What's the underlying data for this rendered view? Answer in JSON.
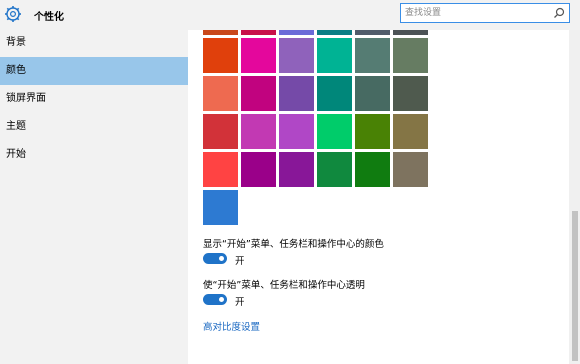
{
  "header": {
    "title": "个性化"
  },
  "search": {
    "placeholder": "查找设置"
  },
  "sidebar": {
    "items": [
      {
        "label": "背景",
        "active": false
      },
      {
        "label": "颜色",
        "active": true
      },
      {
        "label": "锁屏界面",
        "active": false
      },
      {
        "label": "主题",
        "active": false
      },
      {
        "label": "开始",
        "active": false
      }
    ]
  },
  "colors": {
    "accent": "#1f73c8",
    "selected_nav": "#98c6ea",
    "swatch_rows": [
      [
        "#c9481a",
        "#c8104a",
        "#6b6bd8",
        "#0a7e85",
        "#515c6b",
        "#4c5356"
      ],
      [
        "#e0400c",
        "#e4079c",
        "#8f62bb",
        "#00b394",
        "#557c73",
        "#667c62"
      ],
      [
        "#ee6a50",
        "#c1037f",
        "#754aa8",
        "#00877a",
        "#476a62",
        "#4f5a4e"
      ],
      [
        "#d23239",
        "#c239b3",
        "#b047c6",
        "#00cc6a",
        "#498205",
        "#847545"
      ],
      [
        "#ff4343",
        "#9a0089",
        "#881798",
        "#10893e",
        "#107c10",
        "#7e735f"
      ],
      [
        "#2d7ad2"
      ]
    ]
  },
  "settings": {
    "show_color_label": "显示“开始”菜单、任务栏和操作中心的颜色",
    "show_color_state": "开",
    "transparent_label": "使“开始”菜单、任务栏和操作中心透明",
    "transparent_state": "开",
    "high_contrast_link": "高对比度设置"
  }
}
